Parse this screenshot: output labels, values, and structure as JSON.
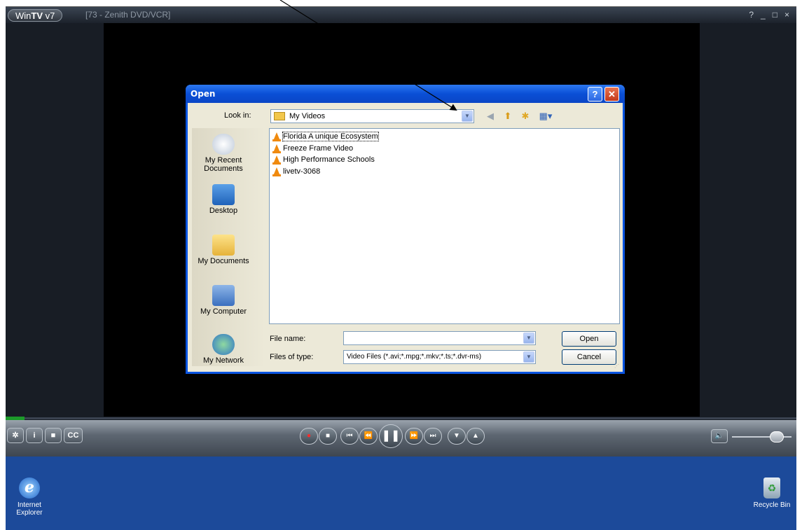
{
  "wintv": {
    "logo_prefix": "Win",
    "logo_bold": "TV",
    "logo_suffix": " v7",
    "title": "[73 - Zenith DVD/VCR]",
    "controls": {
      "help": "?",
      "minimize": "_",
      "maximize": "□",
      "close": "×"
    },
    "buttons": {
      "settings": "✲",
      "info": "i",
      "snapshot": "■",
      "cc": "CC"
    },
    "transport": {
      "record": "●",
      "stop": "■",
      "prev": "⏮",
      "rewind": "⏪",
      "pause": "❚❚",
      "forward": "⏩",
      "next": "⏭",
      "ch_down": "▼",
      "ch_up": "▲"
    },
    "volume_icon": "🔈"
  },
  "dialog": {
    "title": "Open",
    "help_btn": "?",
    "close_btn": "✕",
    "look_in_label": "Look in:",
    "look_in_value": "My Videos",
    "places": [
      {
        "label": "My Recent Documents"
      },
      {
        "label": "Desktop"
      },
      {
        "label": "My Documents"
      },
      {
        "label": "My Computer"
      },
      {
        "label": "My Network"
      }
    ],
    "files": [
      {
        "name": "Florida A unique Ecosystem"
      },
      {
        "name": "Freeze Frame Video"
      },
      {
        "name": "High Performance Schools"
      },
      {
        "name": "livetv-3068"
      }
    ],
    "file_name_label": "File name:",
    "file_name_value": "",
    "files_of_type_label": "Files of type:",
    "files_of_type_value": "Video Files (*.avi;*.mpg;*.mkv;*.ts;*.dvr-ms)",
    "open_button": "Open",
    "cancel_button": "Cancel"
  },
  "desktop": {
    "icons": [
      {
        "label": "Internet Explorer"
      },
      {
        "label": "Recycle Bin"
      }
    ]
  }
}
